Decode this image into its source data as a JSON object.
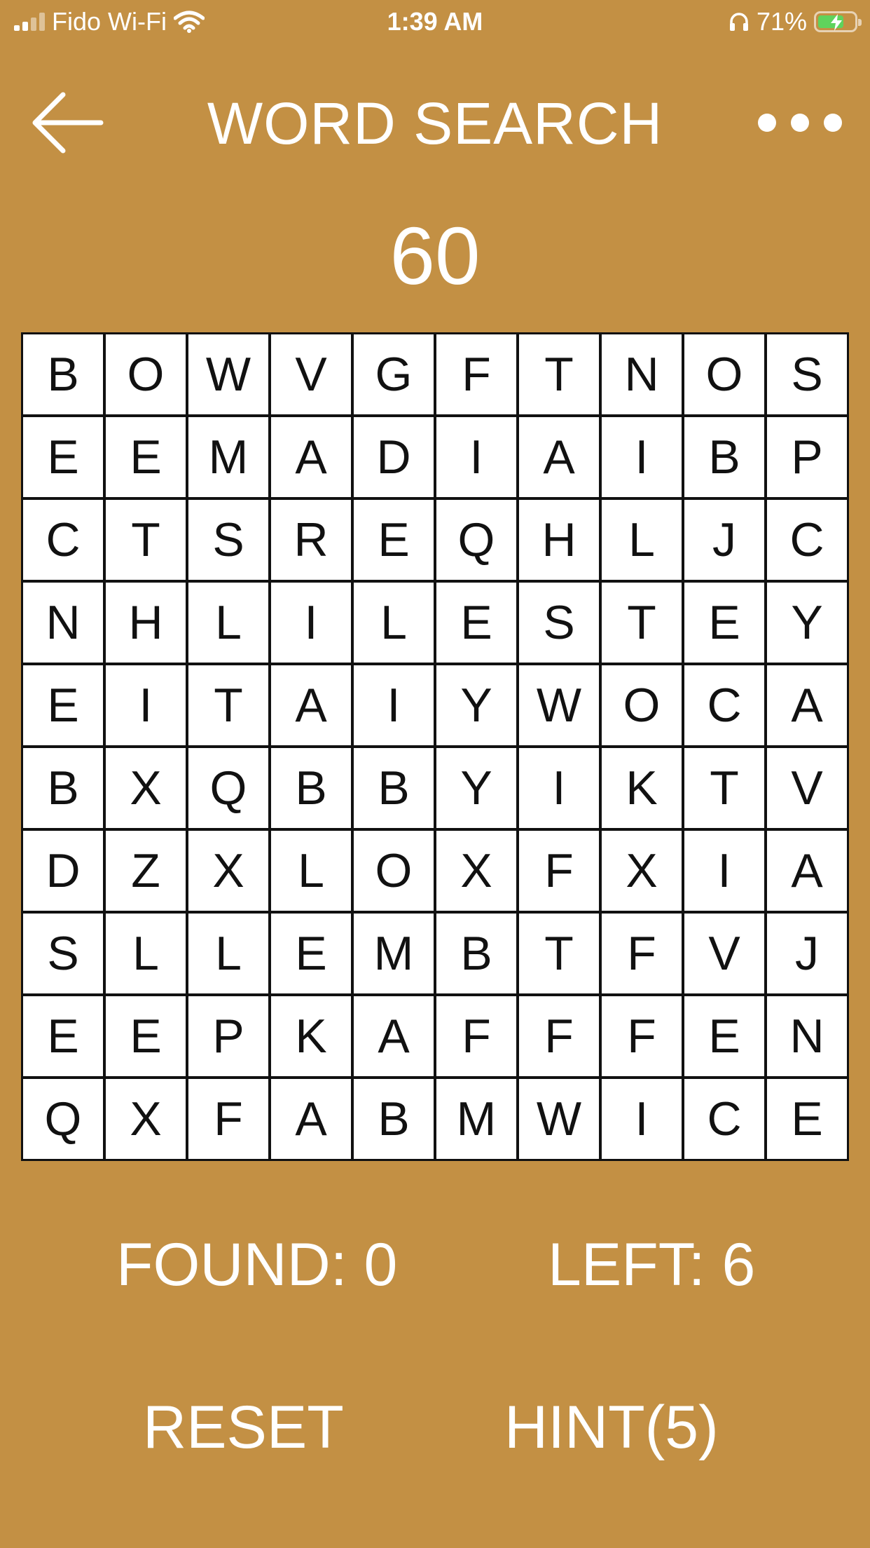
{
  "status_bar": {
    "carrier": "Fido Wi-Fi",
    "time": "1:39 AM",
    "battery_percent": "71%",
    "battery_level": 0.71,
    "battery_fill_color": "#5FD35C",
    "icons": [
      "signal-bars-icon",
      "wifi-icon",
      "headphones-icon",
      "battery-charging-icon"
    ]
  },
  "header": {
    "title": "WORD SEARCH",
    "back_icon": "arrow-left-icon",
    "more_icon": "ellipsis-icon"
  },
  "timer": "60",
  "grid": [
    [
      "B",
      "O",
      "W",
      "V",
      "G",
      "F",
      "T",
      "N",
      "O",
      "S"
    ],
    [
      "E",
      "E",
      "M",
      "A",
      "D",
      "I",
      "A",
      "I",
      "B",
      "P"
    ],
    [
      "C",
      "T",
      "S",
      "R",
      "E",
      "Q",
      "H",
      "L",
      "J",
      "C"
    ],
    [
      "N",
      "H",
      "L",
      "I",
      "L",
      "E",
      "S",
      "T",
      "E",
      "Y"
    ],
    [
      "E",
      "I",
      "T",
      "A",
      "I",
      "Y",
      "W",
      "O",
      "C",
      "A"
    ],
    [
      "B",
      "X",
      "Q",
      "B",
      "B",
      "Y",
      "I",
      "K",
      "T",
      "V"
    ],
    [
      "D",
      "Z",
      "X",
      "L",
      "O",
      "X",
      "F",
      "X",
      "I",
      "A"
    ],
    [
      "S",
      "L",
      "L",
      "E",
      "M",
      "B",
      "T",
      "F",
      "V",
      "J"
    ],
    [
      "E",
      "E",
      "P",
      "K",
      "A",
      "F",
      "F",
      "F",
      "E",
      "N"
    ],
    [
      "Q",
      "X",
      "F",
      "A",
      "B",
      "M",
      "W",
      "I",
      "C",
      "E"
    ]
  ],
  "counters": {
    "found": "FOUND: 0",
    "left": "LEFT: 6"
  },
  "actions": {
    "reset": "RESET",
    "hint": "HINT(5)"
  },
  "colors": {
    "background": "#C39044",
    "cell_background": "#FFFFFF",
    "cell_text": "#111111",
    "grid_lines": "#111111",
    "foreground": "#FFFFFF"
  }
}
